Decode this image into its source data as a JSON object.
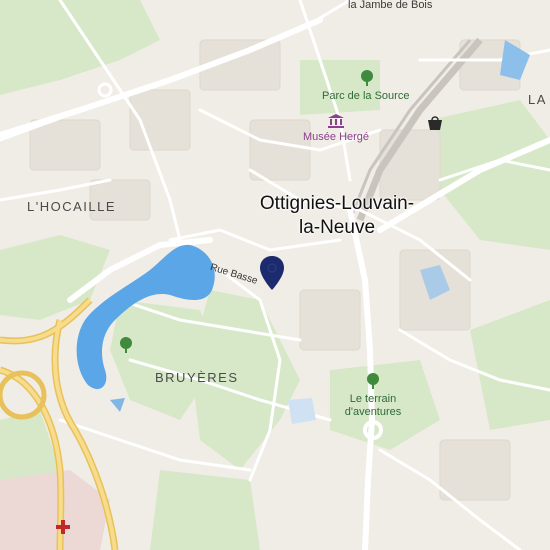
{
  "map": {
    "city": {
      "line1": "Ottignies-Louvain-",
      "line2": "la-Neuve"
    },
    "districts": {
      "hocaille": "L'HOCAILLE",
      "bruyeres": "BRUYÈRES",
      "edge_right": "LA"
    },
    "places": {
      "jambe_de_bois": "la Jambe de Bois",
      "parc_source": "Parc de la Source",
      "musee_herge": "Musée Hergé",
      "terrain_line1": "Le terrain",
      "terrain_line2": "d'aventures"
    },
    "street": "Rue Basse",
    "icons": [
      "tree-icon",
      "museum-icon",
      "shopping-bag-icon",
      "location-pin-icon",
      "hospital-cross-icon"
    ],
    "colors": {
      "land": "#f2efe9",
      "park": "#d6e8c9",
      "water": "#5ba6e6",
      "road": "#ffffff",
      "highway": "#f2d479",
      "pin": "#1c2b6e",
      "hospital": "#e9d3d3"
    }
  }
}
